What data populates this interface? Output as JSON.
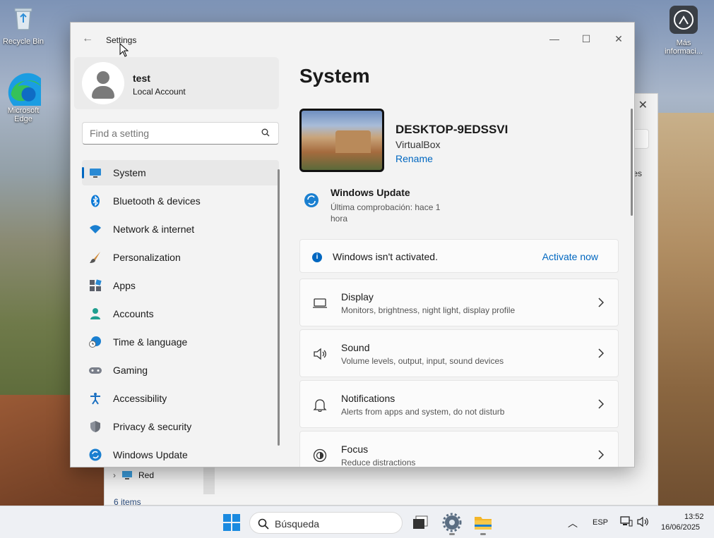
{
  "desktop": {
    "icons": [
      {
        "label": "Recycle Bin",
        "icon": "recycle-bin-icon"
      },
      {
        "label": "Microsoft Edge",
        "icon": "edge-icon"
      },
      {
        "label": "Más informaci...",
        "icon": "info-circle-icon"
      }
    ]
  },
  "background_window": {
    "partial_text": "es",
    "nav_item": "Red",
    "item_count": "6 items"
  },
  "window": {
    "title": "Settings",
    "controls": {
      "minimize": "—",
      "maximize": "☐",
      "close": "✕"
    }
  },
  "profile": {
    "name": "test",
    "account_type": "Local Account"
  },
  "search": {
    "placeholder": "Find a setting"
  },
  "nav": {
    "items": [
      {
        "label": "System",
        "icon": "system-monitor-icon",
        "active": true
      },
      {
        "label": "Bluetooth & devices",
        "icon": "bluetooth-icon"
      },
      {
        "label": "Network & internet",
        "icon": "wifi-icon"
      },
      {
        "label": "Personalization",
        "icon": "brush-icon"
      },
      {
        "label": "Apps",
        "icon": "apps-icon"
      },
      {
        "label": "Accounts",
        "icon": "accounts-icon"
      },
      {
        "label": "Time & language",
        "icon": "globe-clock-icon"
      },
      {
        "label": "Gaming",
        "icon": "gamepad-icon"
      },
      {
        "label": "Accessibility",
        "icon": "accessibility-icon"
      },
      {
        "label": "Privacy & security",
        "icon": "shield-icon"
      },
      {
        "label": "Windows Update",
        "icon": "windows-update-icon"
      }
    ]
  },
  "main": {
    "title": "System",
    "device": {
      "name": "DESKTOP-9EDSSVI",
      "model": "VirtualBox",
      "rename_label": "Rename"
    },
    "windows_update": {
      "title": "Windows Update",
      "subtitle": "Última comprobación: hace 1 hora"
    },
    "activation": {
      "message": "Windows isn't activated.",
      "action_label": "Activate now"
    },
    "cards": [
      {
        "title": "Display",
        "subtitle": "Monitors, brightness, night light, display profile",
        "icon": "display-icon"
      },
      {
        "title": "Sound",
        "subtitle": "Volume levels, output, input, sound devices",
        "icon": "speaker-icon"
      },
      {
        "title": "Notifications",
        "subtitle": "Alerts from apps and system, do not disturb",
        "icon": "bell-icon"
      },
      {
        "title": "Focus",
        "subtitle": "Reduce distractions",
        "icon": "focus-icon"
      }
    ]
  },
  "taskbar": {
    "search_placeholder": "Búsqueda",
    "language": "ESP",
    "time": "13:52",
    "date": "16/06/2025"
  },
  "colors": {
    "accent": "#0067c0",
    "window_bg": "#f3f3f3",
    "card_bg": "#fbfbfb"
  }
}
